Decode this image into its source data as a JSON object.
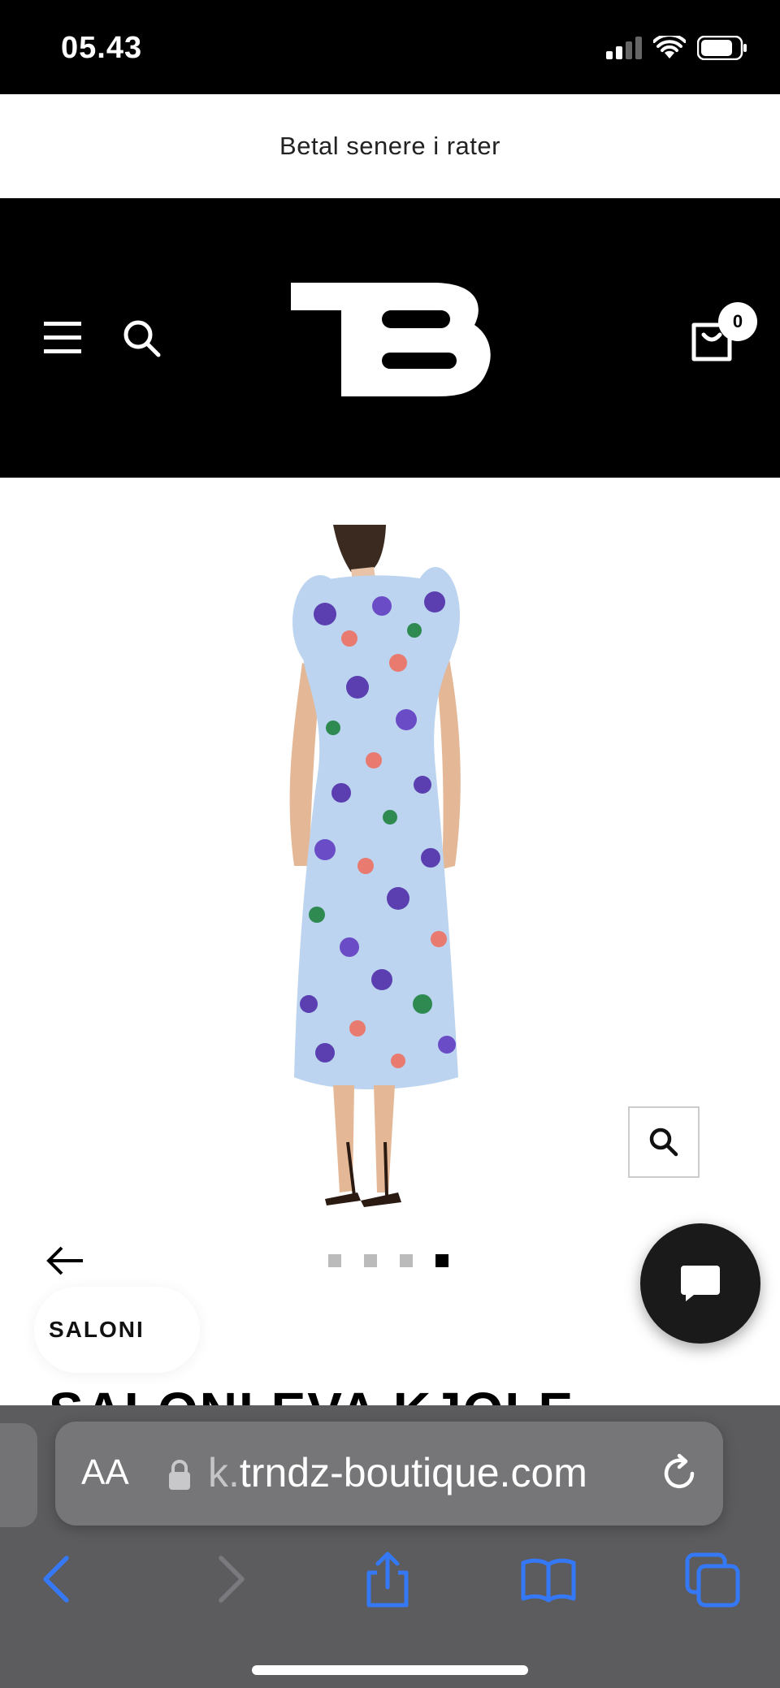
{
  "status_bar": {
    "time": "05.43"
  },
  "announcement": {
    "text": "Betal senere i rater"
  },
  "header": {
    "cart_count": "0"
  },
  "product": {
    "brand": "SALONI",
    "title": "SALONI EVA KJOLE",
    "image_dots": {
      "count": 4,
      "active_index": 4
    }
  },
  "browser": {
    "aa_label": "AA",
    "url_faded": "k.",
    "url_main": "trndz-boutique.com"
  },
  "colors": {
    "header_bg": "#000000",
    "accent_blue": "#3478f6",
    "safari_bar": "#5c5c5e"
  }
}
